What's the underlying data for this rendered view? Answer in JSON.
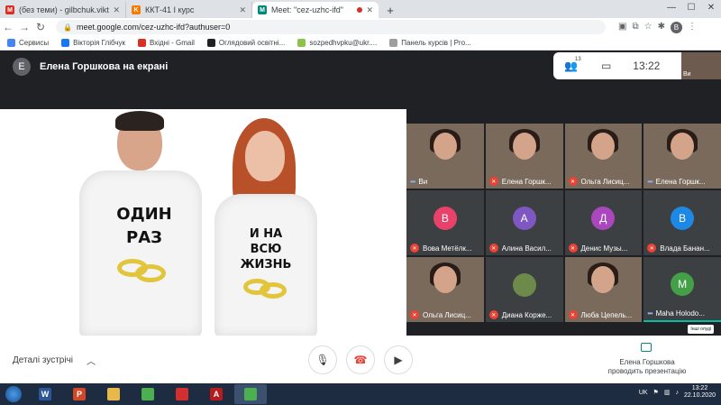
{
  "browser": {
    "tabs": [
      {
        "title": "(без теми) - gilbchuk.viktoria@gm",
        "icon": "gmail-icon",
        "color": "#d93025",
        "glyph": "M"
      },
      {
        "title": "ККТ-41 І курс",
        "icon": "classroom-icon",
        "color": "#f57c00",
        "glyph": "K"
      },
      {
        "title": "Meet: \"cez-uzhc-ifd\"",
        "icon": "meet-icon",
        "color": "#00897b",
        "glyph": "M"
      }
    ],
    "new_tab": "+",
    "url": "meet.google.com/cez-uzhc-ifd?authuser=0",
    "profile_initial": "B",
    "bookmarks": [
      {
        "label": "Сервисы",
        "color": "#4285f4"
      },
      {
        "label": "Вікторія Глібчук",
        "color": "#1877f2"
      },
      {
        "label": "Вхідні - Gmail",
        "color": "#d93025"
      },
      {
        "label": "Оглядовий освітні...",
        "color": "#202124"
      },
      {
        "label": "sozpedhvpku@ukr....",
        "color": "#8bc34a"
      },
      {
        "label": "Панель курсів | Pro...",
        "color": "#9e9e9e"
      }
    ]
  },
  "meet": {
    "presenter_initial": "Е",
    "presenter_text": "Елена Горшкова на екрані",
    "participants_count": "13",
    "time": "13:22",
    "self_label": "Ви",
    "slide": {
      "man_shirt_text": [
        "ОДИН",
        "РАЗ"
      ],
      "woman_shirt_text": [
        "И НА",
        "ВСЮ",
        "ЖИЗНЬ"
      ]
    },
    "tiles": [
      {
        "name": "Ви",
        "type": "photo",
        "muted": false
      },
      {
        "name": "Елена Горшк...",
        "type": "photo",
        "muted": true
      },
      {
        "name": "Ольга Лисиц...",
        "type": "photo",
        "muted": true
      },
      {
        "name": "Елена Горшк...",
        "type": "photo",
        "muted": false
      },
      {
        "name": "Вова Метёлк...",
        "type": "avatar",
        "initial": "В",
        "color": "#e8426a",
        "muted": true
      },
      {
        "name": "Алина Васил...",
        "type": "avatar",
        "initial": "А",
        "color": "#7e57c2",
        "muted": true
      },
      {
        "name": "Денис Музы...",
        "type": "avatar",
        "initial": "Д",
        "color": "#ab47bc",
        "muted": true
      },
      {
        "name": "Влада Банан...",
        "type": "avatar",
        "initial": "В",
        "color": "#1e88e5",
        "muted": true
      },
      {
        "name": "Ольга Лисиц...",
        "type": "photo",
        "muted": true
      },
      {
        "name": "Диана Корже...",
        "type": "avatar",
        "initial": "",
        "color": "#6d8a4a",
        "muted": true
      },
      {
        "name": "Люба Цепель...",
        "type": "photo",
        "muted": true
      },
      {
        "name": "Maha Holodo...",
        "type": "avatar",
        "initial": "M",
        "color": "#43a047",
        "muted": false
      }
    ],
    "more_tag": "Інші олуді",
    "details_label": "Деталі зустрічі",
    "presenting_label_1": "Елена Горшкова",
    "presenting_label_2": "проводить презентацію"
  },
  "taskbar": {
    "lang": "UK",
    "time": "13:22",
    "date": "22.10.2020",
    "apps": [
      {
        "name": "word",
        "color": "#2b579a",
        "glyph": "W"
      },
      {
        "name": "powerpoint",
        "color": "#d24726",
        "glyph": "P"
      },
      {
        "name": "explorer",
        "color": "#e8b84a",
        "glyph": ""
      },
      {
        "name": "chrome",
        "color": "#4caf50",
        "glyph": ""
      },
      {
        "name": "opera",
        "color": "#d32f2f",
        "glyph": ""
      },
      {
        "name": "acrobat",
        "color": "#b71c1c",
        "glyph": "A"
      },
      {
        "name": "chrome-active",
        "color": "#4caf50",
        "glyph": ""
      }
    ]
  }
}
